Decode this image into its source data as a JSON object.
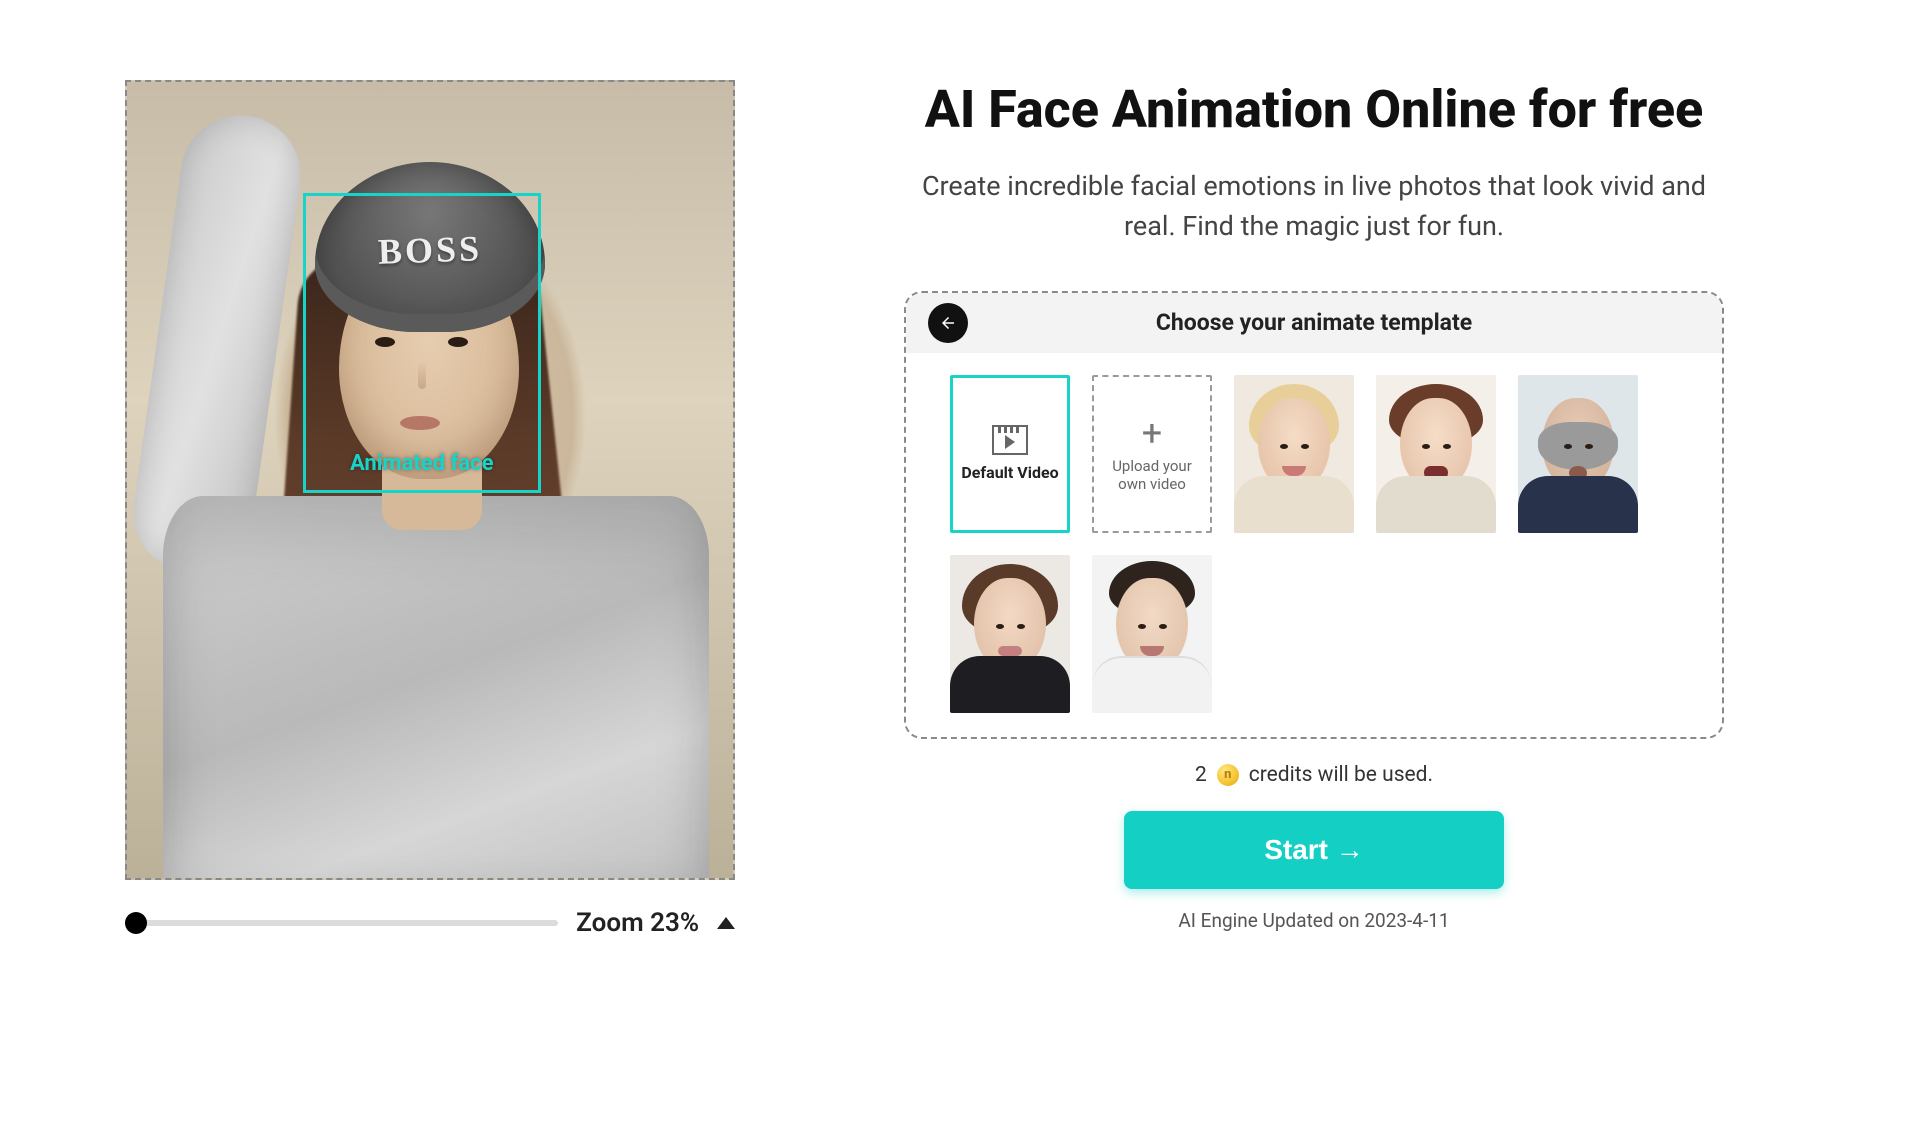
{
  "colors": {
    "accent": "#17d3c9",
    "cta": "#14cfc4"
  },
  "canvas": {
    "face_box_label": "Animated face",
    "beanie_text": "BOSS"
  },
  "zoom": {
    "label": "Zoom 23%",
    "value_percent": 23
  },
  "header": {
    "title": "AI Face Animation Online for free",
    "subtitle": "Create incredible facial emotions in live photos that look vivid and real. Find the magic just for fun."
  },
  "templates": {
    "panel_title": "Choose your animate template",
    "items": [
      {
        "kind": "default",
        "label": "Default Video",
        "selected": true
      },
      {
        "kind": "upload",
        "label": "Upload your own video"
      },
      {
        "kind": "sample",
        "label": "sample-face-1"
      },
      {
        "kind": "sample",
        "label": "sample-face-2"
      },
      {
        "kind": "sample",
        "label": "sample-face-3"
      },
      {
        "kind": "sample",
        "label": "sample-face-4"
      },
      {
        "kind": "sample",
        "label": "sample-face-5"
      }
    ]
  },
  "credits": {
    "amount": "2",
    "text": "credits will be used."
  },
  "cta": {
    "label": "Start →"
  },
  "engine": {
    "text": "AI Engine Updated on 2023-4-11"
  }
}
